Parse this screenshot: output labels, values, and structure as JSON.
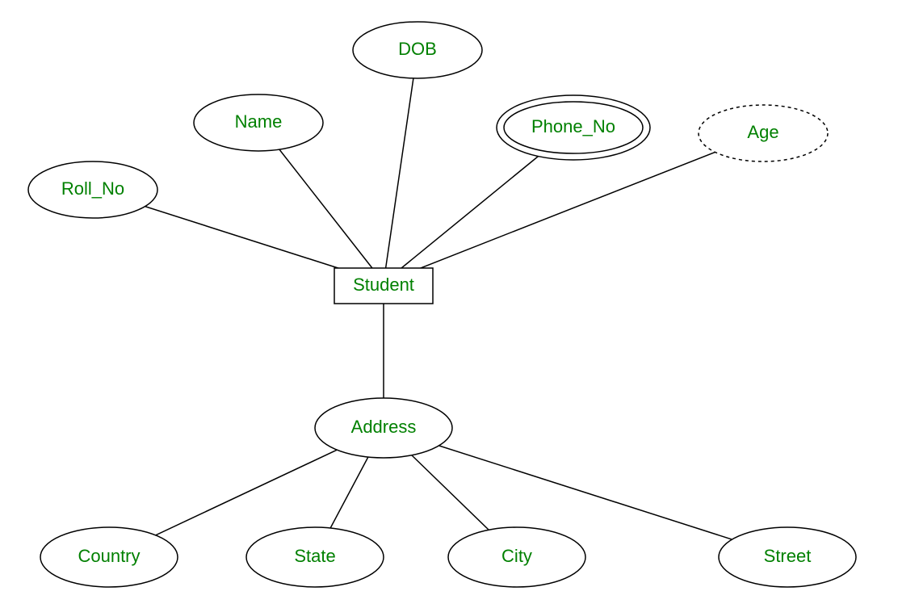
{
  "diagram": {
    "entity": {
      "label": "Student"
    },
    "attributes": {
      "roll_no": {
        "label": "Roll_No"
      },
      "name": {
        "label": "Name"
      },
      "dob": {
        "label": "DOB"
      },
      "phone_no": {
        "label": "Phone_No"
      },
      "age": {
        "label": "Age"
      },
      "address": {
        "label": "Address"
      },
      "country": {
        "label": "Country"
      },
      "state": {
        "label": "State"
      },
      "city": {
        "label": "City"
      },
      "street": {
        "label": "Street"
      }
    }
  }
}
